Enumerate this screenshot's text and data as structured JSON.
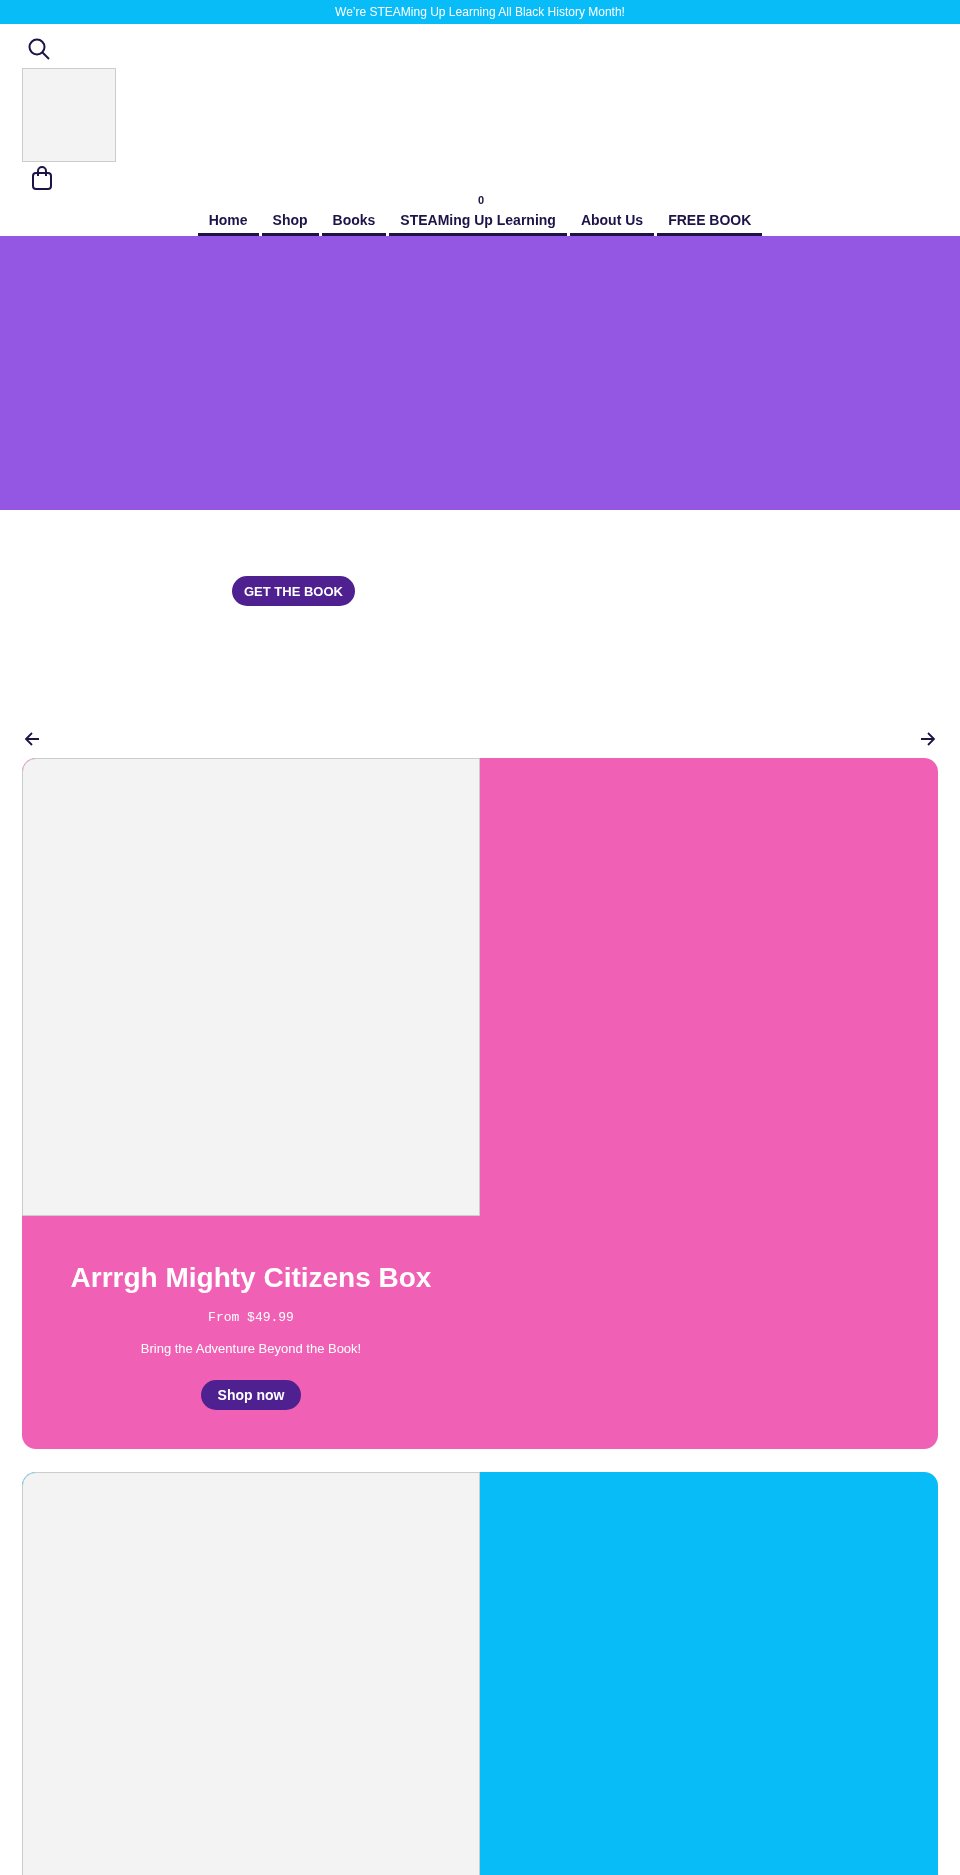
{
  "announcement": "We’re STEAMing Up Learning All Black History Month!",
  "header": {
    "cart_count": "0"
  },
  "nav": [
    "Home",
    "Shop",
    "Books",
    "STEAMing Up Learning",
    "About Us",
    "FREE BOOK"
  ],
  "hero": {
    "button": "GET THE BOOK"
  },
  "cards": [
    {
      "color": "#f061b6",
      "title": "Arrrgh Mighty Citizens Box",
      "price": "From $49.99",
      "tagline": "Bring the Adventure Beyond the Book!",
      "button": "Shop now"
    },
    {
      "color": "#08bcf8"
    }
  ]
}
